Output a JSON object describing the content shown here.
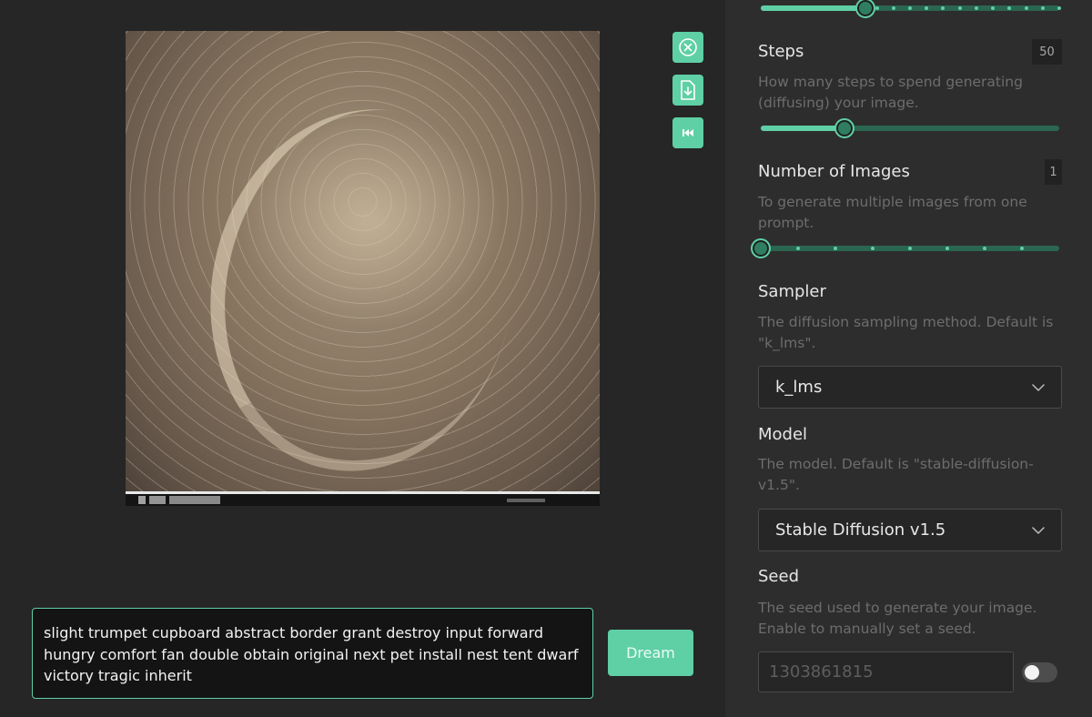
{
  "canvas": {
    "actions": [
      {
        "id": "clear",
        "icon": "close-circle-icon"
      },
      {
        "id": "download",
        "icon": "file-download-icon"
      },
      {
        "id": "rewind",
        "icon": "rewind-icon"
      }
    ]
  },
  "prompt": {
    "text": "slight trumpet cupboard abstract border grant destroy input forward hungry comfort fan double obtain original next pet install nest tent dwarf victory tragic inherit"
  },
  "dream_button": {
    "label": "Dream"
  },
  "sidebar": {
    "top_slider": {
      "value_fraction": 0.35
    },
    "steps": {
      "title": "Steps",
      "value": "50",
      "description": "How many steps to spend generating (diffusing) your image.",
      "value_fraction": 0.28
    },
    "images": {
      "title": "Number of Images",
      "value": "1",
      "description": "To generate multiple images from one prompt.",
      "value_fraction": 0.0
    },
    "sampler": {
      "title": "Sampler",
      "description": "The diffusion sampling method. Default is \"k_lms\".",
      "selected": "k_lms"
    },
    "model": {
      "title": "Model",
      "description": "The model. Default is \"stable-diffusion-v1.5\".",
      "selected": "Stable Diffusion v1.5"
    },
    "seed": {
      "title": "Seed",
      "description": "The seed used to generate your image. Enable to manually set a seed.",
      "placeholder": "1303861815",
      "enabled": false
    }
  },
  "colors": {
    "accent": "#5fcfa6",
    "rail": "#2a6650",
    "background": "#262626",
    "sidebar": "#2d2d2d"
  }
}
